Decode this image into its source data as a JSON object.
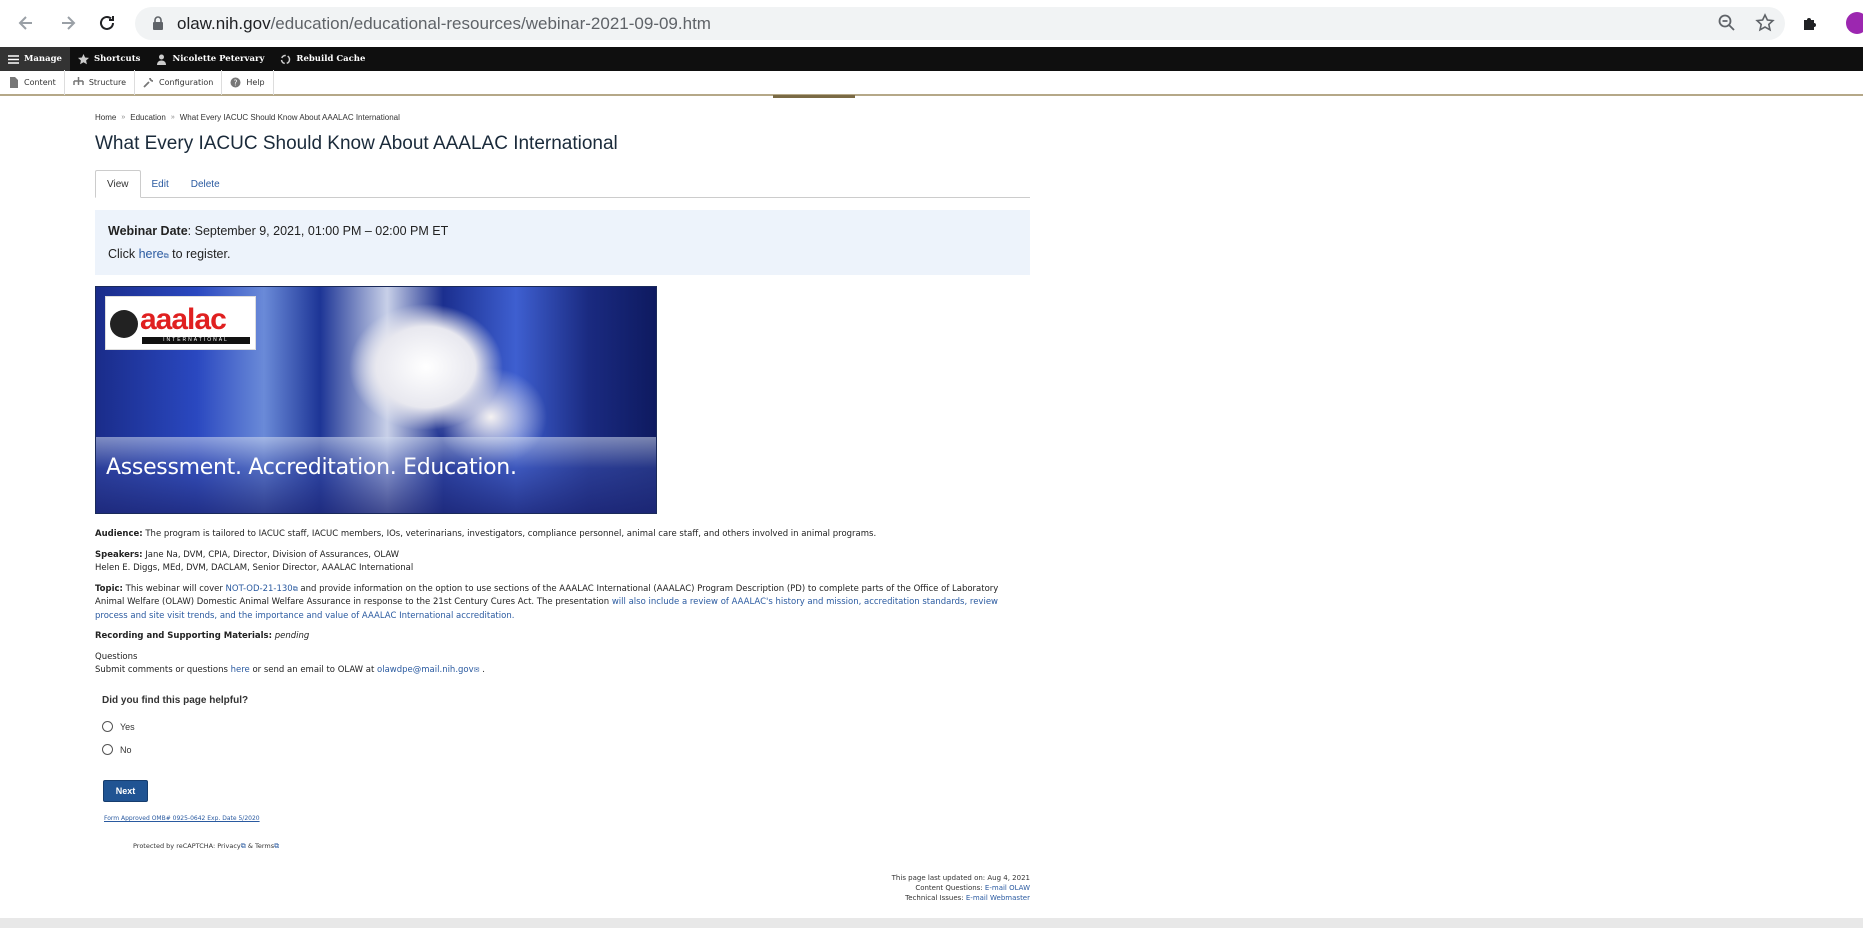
{
  "browser": {
    "url_host": "olaw.nih.gov",
    "url_path": "/education/educational-resources/webinar-2021-09-09.htm"
  },
  "toolbar": {
    "manage": "Manage",
    "shortcuts": "Shortcuts",
    "user": "Nicolette Petervary",
    "rebuild_cache": "Rebuild Cache"
  },
  "tray": {
    "content": "Content",
    "structure": "Structure",
    "configuration": "Configuration",
    "help": "Help"
  },
  "breadcrumb": {
    "home": "Home",
    "education": "Education",
    "current": "What Every IACUC Should Know About AAALAC International"
  },
  "page": {
    "title": "What Every IACUC Should Know About AAALAC International"
  },
  "tabs": {
    "view": "View",
    "edit": "Edit",
    "delete": "Delete"
  },
  "notice": {
    "date_label": "Webinar Date",
    "date_value": ": September 9, 2021, 01:00 PM – 02:00 PM ET",
    "click": "Click",
    "here": "here",
    "register": "to register."
  },
  "banner": {
    "logo_text": "aaalac",
    "logo_sub": "INTERNATIONAL",
    "caption": "Assessment. Accreditation. Education."
  },
  "details": {
    "audience_label": "Audience:",
    "audience_text": " The program is tailored to IACUC staff, IACUC members, IOs, veterinarians, investigators, compliance personnel, animal care staff, and others involved in animal programs.",
    "speakers_label": "Speakers:",
    "speaker1": " Jane Na, DVM, CPIA, Director, Division of Assurances, OLAW",
    "speaker2": "Helen E. Diggs, MEd, DVM, DACLAM, Senior Director, AAALAC International",
    "topic_label": "Topic:",
    "topic_pre": " This webinar will cover ",
    "topic_link": "NOT-OD-21-130",
    "topic_mid": "  and provide information on the option to use sections of the AAALAC International (AAALAC) Program Description (PD) to complete parts of the Office of Laboratory Animal Welfare (OLAW) Domestic Animal Welfare Assurance in response to the 21st Century Cures Act. The presentation ",
    "topic_blue": "will also include a review of AAALAC's history and mission, accreditation standards, review process and site visit trends, and the importance and value of AAALAC International accreditation.",
    "recording_label": "Recording and Supporting Materials:",
    "recording_value": "pending",
    "questions_title": "Questions",
    "questions_pre": "Submit comments or questions ",
    "questions_here": "here",
    "questions_mid": " or send an email to OLAW at ",
    "questions_email": "olawdpe@mail.nih.gov",
    "questions_end": " ."
  },
  "feedback": {
    "question": "Did you find this page helpful?",
    "yes": "Yes",
    "no": "No",
    "next": "Next",
    "omb": "Form Approved OMB# 0925-0642 Exp. Date 5/2020",
    "recaptcha": "Protected by reCAPTCHA: Privacy",
    "recaptcha_amp": " & ",
    "recaptcha_terms": "Terms"
  },
  "footer": {
    "updated": "This page last updated on: Aug 4, 2021",
    "content_q": "Content Questions: ",
    "content_link": "E-mail OLAW",
    "tech": "Technical Issues: ",
    "tech_link": "E-mail Webmaster"
  }
}
